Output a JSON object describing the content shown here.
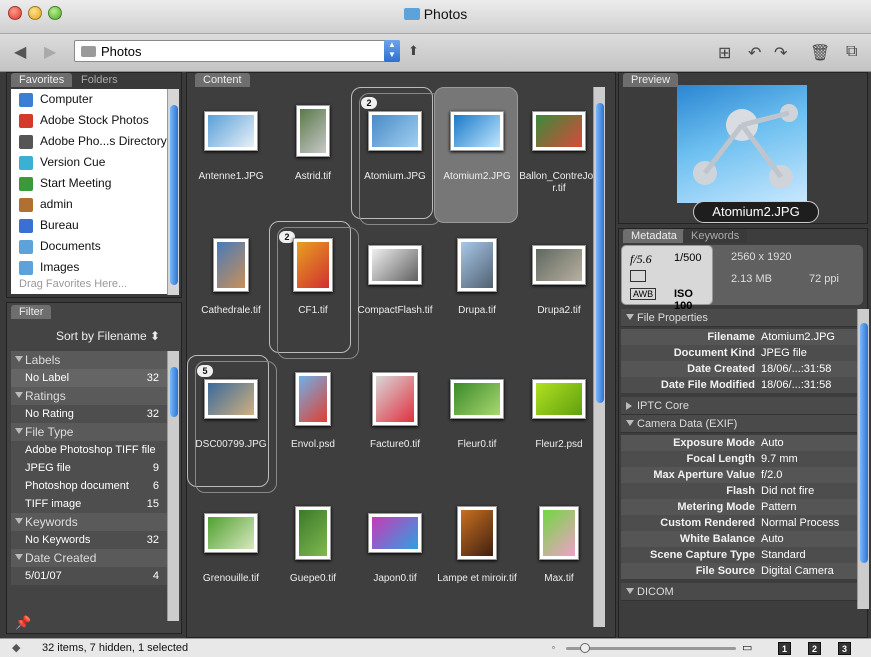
{
  "window": {
    "title": "Photos"
  },
  "toolbar": {
    "path": "Photos"
  },
  "favorites": {
    "tabs": [
      "Favorites",
      "Folders"
    ],
    "items": [
      {
        "label": "Computer",
        "icon": "computer-icon",
        "color": "#3a7fd4"
      },
      {
        "label": "Adobe Stock Photos",
        "icon": "stock-photos-icon",
        "color": "#d43a2a"
      },
      {
        "label": "Adobe Pho...s Directory",
        "icon": "photoshop-services-icon",
        "color": "#555555"
      },
      {
        "label": "Version Cue",
        "icon": "version-cue-icon",
        "color": "#3ab0d4"
      },
      {
        "label": "Start Meeting",
        "icon": "meeting-icon",
        "color": "#3a9a3a"
      },
      {
        "label": "admin",
        "icon": "home-icon",
        "color": "#b07030"
      },
      {
        "label": "Bureau",
        "icon": "desktop-icon",
        "color": "#3a6fd4"
      },
      {
        "label": "Documents",
        "icon": "documents-folder-icon",
        "color": "#5da2d8"
      },
      {
        "label": "Images",
        "icon": "images-folder-icon",
        "color": "#5da2d8"
      }
    ],
    "drag_hint": "Drag Favorites Here..."
  },
  "filter": {
    "tab": "Filter",
    "sort_label": "Sort by Filename",
    "sections": [
      {
        "title": "Labels",
        "rows": [
          {
            "label": "No Label",
            "count": "32"
          }
        ]
      },
      {
        "title": "Ratings",
        "rows": [
          {
            "label": "No Rating",
            "count": "32"
          }
        ]
      },
      {
        "title": "File Type",
        "rows": [
          {
            "label": "Adobe Photoshop TIFF file",
            "count": ""
          },
          {
            "label": "JPEG file",
            "count": "9"
          },
          {
            "label": "Photoshop document",
            "count": "6"
          },
          {
            "label": "TIFF image",
            "count": "15"
          }
        ]
      },
      {
        "title": "Keywords",
        "rows": [
          {
            "label": "No Keywords",
            "count": "32"
          }
        ]
      },
      {
        "title": "Date Created",
        "rows": [
          {
            "label": "5/01/07",
            "count": "4"
          }
        ]
      }
    ]
  },
  "content": {
    "tab": "Content",
    "items": [
      {
        "name": "Antenne1.JPG",
        "c1": "#5aa0d8",
        "c2": "#e8f0f8"
      },
      {
        "name": "Astrid.tif",
        "c1": "#5a7a4a",
        "c2": "#c8c8c8"
      },
      {
        "name": "Atomium.JPG",
        "c1": "#4a8ac8",
        "c2": "#a0d0f0",
        "stack": "2"
      },
      {
        "name": "Atomium2.JPG",
        "c1": "#1a7ac8",
        "c2": "#bfe6ff",
        "selected": true
      },
      {
        "name": "Ballon_ContreJour.tif",
        "c1": "#3a8a3a",
        "c2": "#d84a3a"
      },
      {
        "name": "Cathedrale.tif",
        "c1": "#4a7ab8",
        "c2": "#c89058"
      },
      {
        "name": "CF1.tif",
        "c1": "#e8a020",
        "c2": "#d03030",
        "stack": "2"
      },
      {
        "name": "CompactFlash.tif",
        "c1": "#f0f0f0",
        "c2": "#606060"
      },
      {
        "name": "Drupa.tif",
        "c1": "#a8c8e8",
        "c2": "#506070"
      },
      {
        "name": "Drupa2.tif",
        "c1": "#606860",
        "c2": "#b8b0a0"
      },
      {
        "name": "DSC00799.JPG",
        "c1": "#3a6a9a",
        "c2": "#d0b080",
        "stack": "5"
      },
      {
        "name": "Envol.psd",
        "c1": "#70b0e8",
        "c2": "#e04030"
      },
      {
        "name": "Facture0.tif",
        "c1": "#d8d8d8",
        "c2": "#e03040"
      },
      {
        "name": "Fleur0.tif",
        "c1": "#3a8a2a",
        "c2": "#a8d870"
      },
      {
        "name": "Fleur2.psd",
        "c1": "#b0e020",
        "c2": "#60a010"
      },
      {
        "name": "Grenouille.tif",
        "c1": "#50a030",
        "c2": "#d8e8c0"
      },
      {
        "name": "Guepe0.tif",
        "c1": "#3a7a2a",
        "c2": "#80b850"
      },
      {
        "name": "Japon0.tif",
        "c1": "#c83ab8",
        "c2": "#30a0e0"
      },
      {
        "name": "Lampe et miroir.tif",
        "c1": "#c87020",
        "c2": "#402010"
      },
      {
        "name": "Max.tif",
        "c1": "#70d840",
        "c2": "#f0a0c8"
      }
    ]
  },
  "preview": {
    "tab": "Preview",
    "caption": "Atomium2.JPG"
  },
  "metadata": {
    "tabs": [
      "Metadata",
      "Keywords"
    ],
    "summary": {
      "aperture": "f/5.6",
      "shutter": "1/500",
      "dimensions": "2560 x 1920",
      "filesize": "2.13 MB",
      "ppi": "72 ppi",
      "wb": "AWB",
      "iso": "ISO 100"
    },
    "sections": [
      {
        "title": "File Properties",
        "open": true,
        "rows": [
          {
            "k": "Filename",
            "v": "Atomium2.JPG"
          },
          {
            "k": "Document Kind",
            "v": "JPEG file"
          },
          {
            "k": "Date Created",
            "v": "18/06/...:31:58"
          },
          {
            "k": "Date File Modified",
            "v": "18/06/...:31:58"
          }
        ]
      },
      {
        "title": "IPTC Core",
        "open": false,
        "rows": []
      },
      {
        "title": "Camera Data (EXIF)",
        "open": true,
        "rows": [
          {
            "k": "Exposure Mode",
            "v": "Auto"
          },
          {
            "k": "Focal Length",
            "v": "9.7 mm"
          },
          {
            "k": "Max Aperture Value",
            "v": "f/2.0"
          },
          {
            "k": "Flash",
            "v": "Did not fire"
          },
          {
            "k": "Metering Mode",
            "v": "Pattern"
          },
          {
            "k": "Custom Rendered",
            "v": "Normal Process"
          },
          {
            "k": "White Balance",
            "v": "Auto"
          },
          {
            "k": "Scene Capture Type",
            "v": "Standard"
          },
          {
            "k": "File Source",
            "v": "Digital Camera"
          }
        ]
      },
      {
        "title": "DICOM",
        "open": true,
        "rows": []
      }
    ]
  },
  "status": {
    "text": "32 items, 7 hidden, 1 selected",
    "views": [
      "1",
      "2",
      "3"
    ]
  }
}
